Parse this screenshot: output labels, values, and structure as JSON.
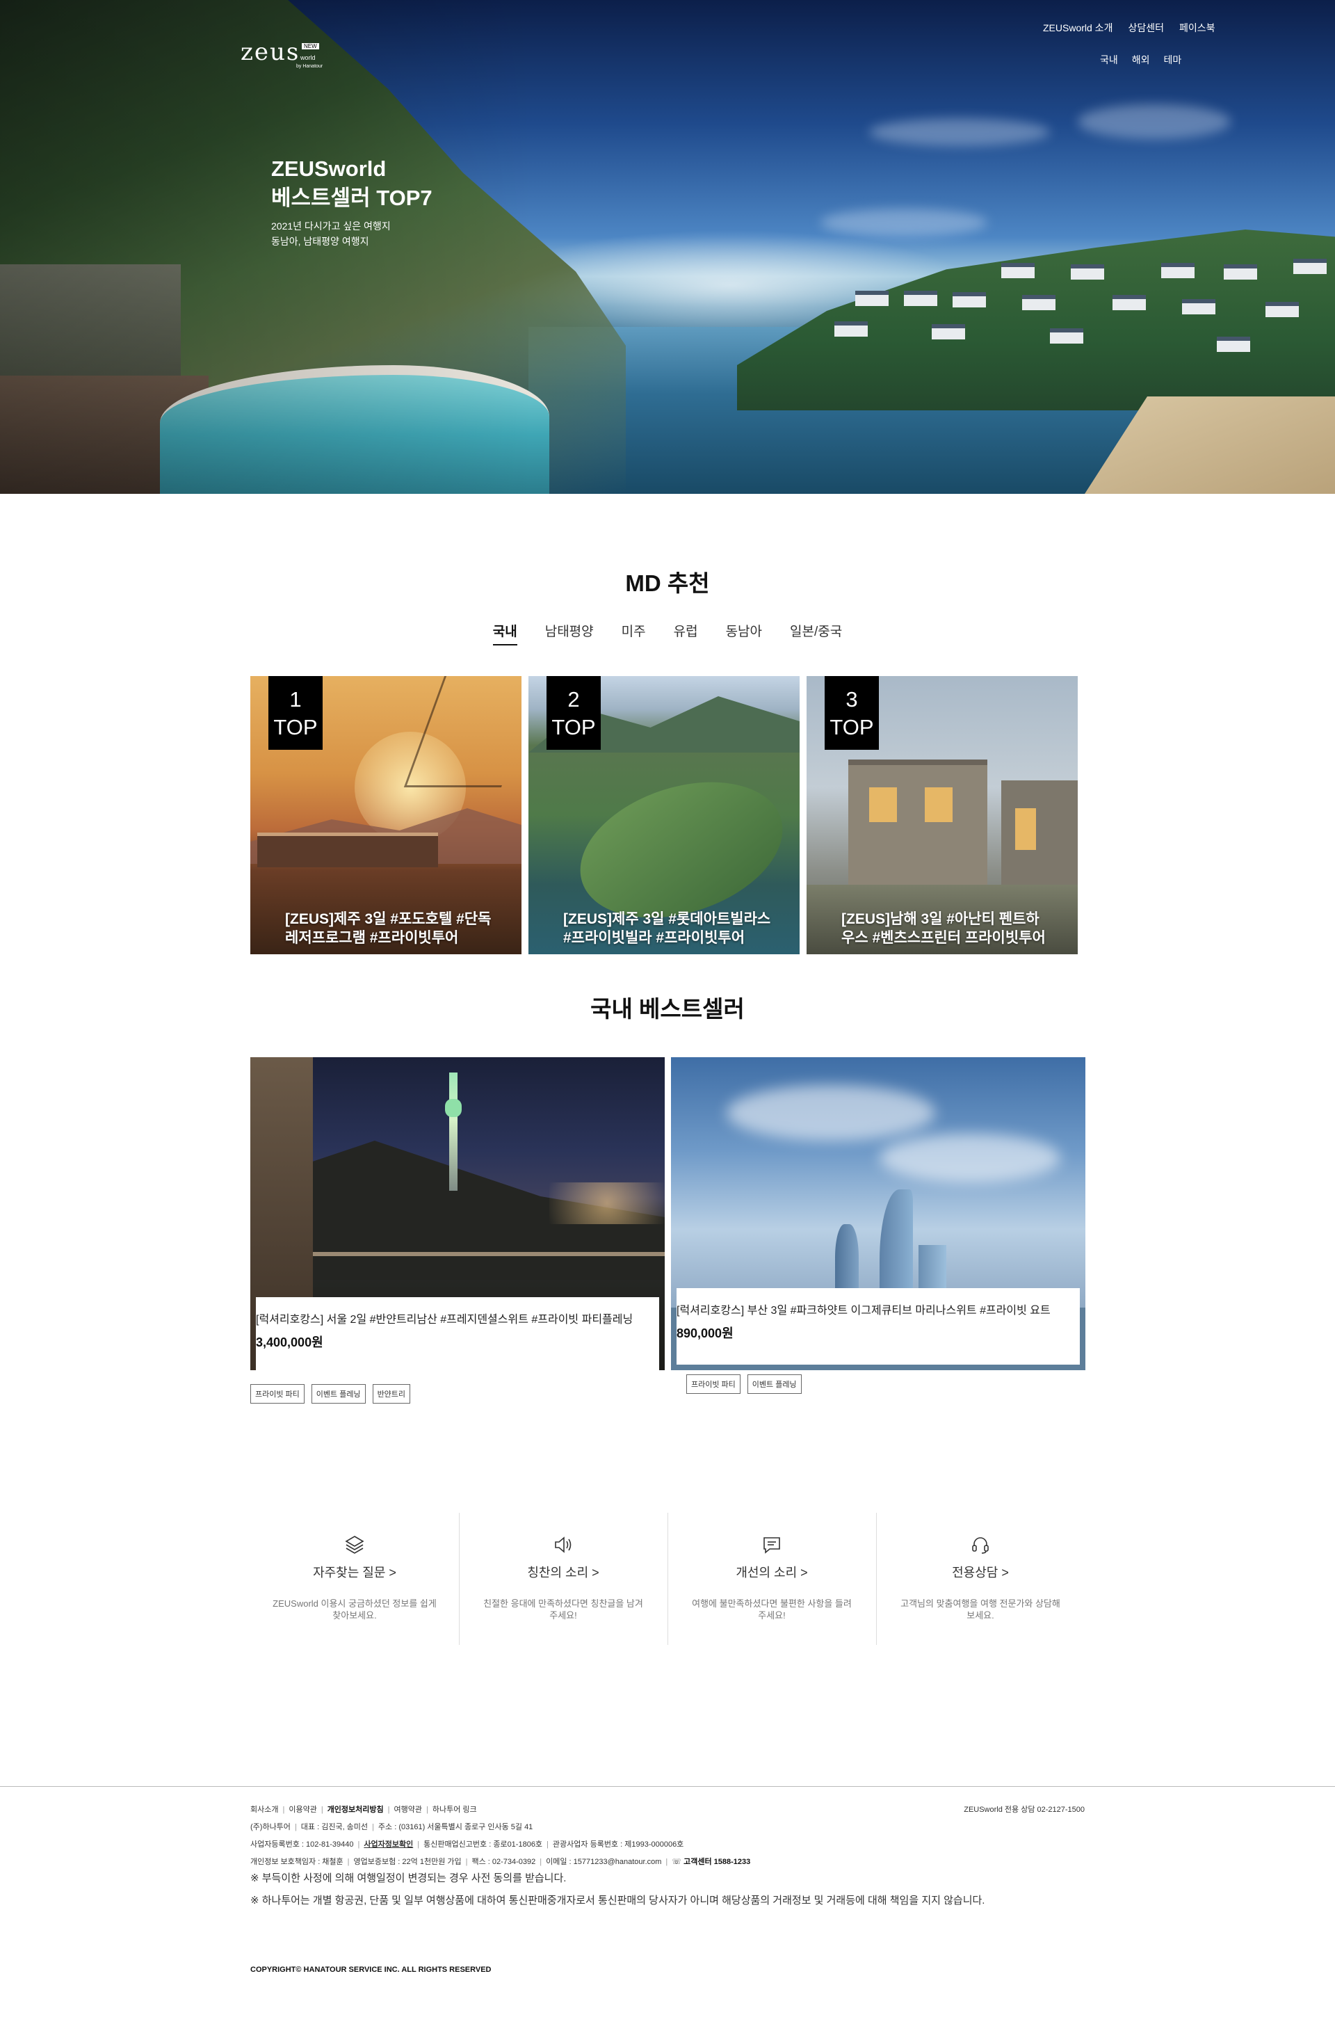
{
  "header": {
    "logo": {
      "word": "zeus",
      "badge": "NEW",
      "sub": "world",
      "by": "by Hanatour"
    },
    "nav_top": [
      "ZEUSworld 소개",
      "상담센터",
      "페이스북"
    ],
    "nav_sub": [
      "국내",
      "해외",
      "테마"
    ]
  },
  "hero": {
    "title_line1": "ZEUSworld",
    "title_line2": "베스트셀러 TOP7",
    "sub_line1": "2021년 다시가고 싶은 여행지",
    "sub_line2": "동남아, 남태평양 여행지"
  },
  "md": {
    "title": "MD 추천",
    "tabs": [
      "국내",
      "남태평양",
      "미주",
      "유럽",
      "동남아",
      "일본/중국"
    ],
    "active_tab": "국내",
    "cards": [
      {
        "rank": "1",
        "label": "TOP",
        "caption": "[ZEUS]제주 3일 #포도호텔 #단독레저프로그램 #프라이빗투어"
      },
      {
        "rank": "2",
        "label": "TOP",
        "caption": "[ZEUS]제주 3일 #롯데아트빌라스 #프라이빗빌라 #프라이빗투어"
      },
      {
        "rank": "3",
        "label": "TOP",
        "caption": "[ZEUS]남해 3일 #아난티 펜트하우스 #벤츠스프린터 프라이빗투어"
      }
    ]
  },
  "bestseller": {
    "title": "국내 베스트셀러",
    "items": [
      {
        "name": "[럭셔리호캉스] 서울 2일 #반얀트리남산 #프레지덴셜스위트 #프라이빗 파티플레닝",
        "price": "3,400,000원",
        "tags": [
          "프라이빗 파티",
          "이벤트 플레닝",
          "반얀트리"
        ]
      },
      {
        "name": "[럭셔리호캉스] 부산 3일 #파크하얏트 이그제큐티브 마리나스위트 #프라이빗 요트",
        "price": "890,000원",
        "tags": [
          "프라이빗 파티",
          "이벤트 플레닝"
        ]
      }
    ]
  },
  "services": [
    {
      "icon": "layers-icon",
      "title": "자주찾는 질문 >",
      "desc": "ZEUSworld 이용시 궁금하셨던 정보를 쉽게 찾아보세요."
    },
    {
      "icon": "speaker-icon",
      "title": "칭찬의 소리 >",
      "desc": "친절한 응대에 만족하셨다면 칭찬글을 남겨주세요!"
    },
    {
      "icon": "chat-icon",
      "title": "개선의 소리 >",
      "desc": "여행에 불만족하셨다면 불편한 사항을 들려주세요!"
    },
    {
      "icon": "headset-icon",
      "title": "전용상담 >",
      "desc": "고객님의 맞춤여행을 여행 전문가와 상담해보세요."
    }
  ],
  "footer": {
    "links": [
      "회사소개",
      "이용약관",
      "개인정보처리방침",
      "여행약관",
      "하나투어 링크"
    ],
    "right_text": "ZEUSworld 전용 상담 02-2127-1500",
    "line1": [
      "(주)하나투어",
      "대표 : 김진국, 송미선",
      "주소 : (03161) 서울특별시 종로구 인사동 5길 41"
    ],
    "line2_a": "사업자등록번호 : 102-81-39440",
    "line2_link": "사업자정보확인",
    "line2_b": "통신판매업신고번호 : 종로01-1806호",
    "line2_c": "관광사업자 등록번호 : 제1993-000006호",
    "line3": [
      "개인정보 보호책임자 : 채철훈",
      "영업보증보험 : 22억 1천만원 가입",
      "팩스 : 02-734-0392",
      "이메일 : 15771233@hanatour.com"
    ],
    "center": "고객센터 1588-1233",
    "notice1": "※ 부득이한 사정에 의해 여행일정이 변경되는 경우 사전 동의를 받습니다.",
    "notice2": "※ 하나투어는 개별 항공권, 단품 및 일부 여행상품에 대하여 통신판매중개자로서 통신판매의 당사자가 아니며 해당상품의 거래정보 및 거래등에 대해 책임을 지지 않습니다.",
    "copyright": "COPYRIGHT© HANATOUR SERVICE INC. ALL RIGHTS RESERVED"
  }
}
